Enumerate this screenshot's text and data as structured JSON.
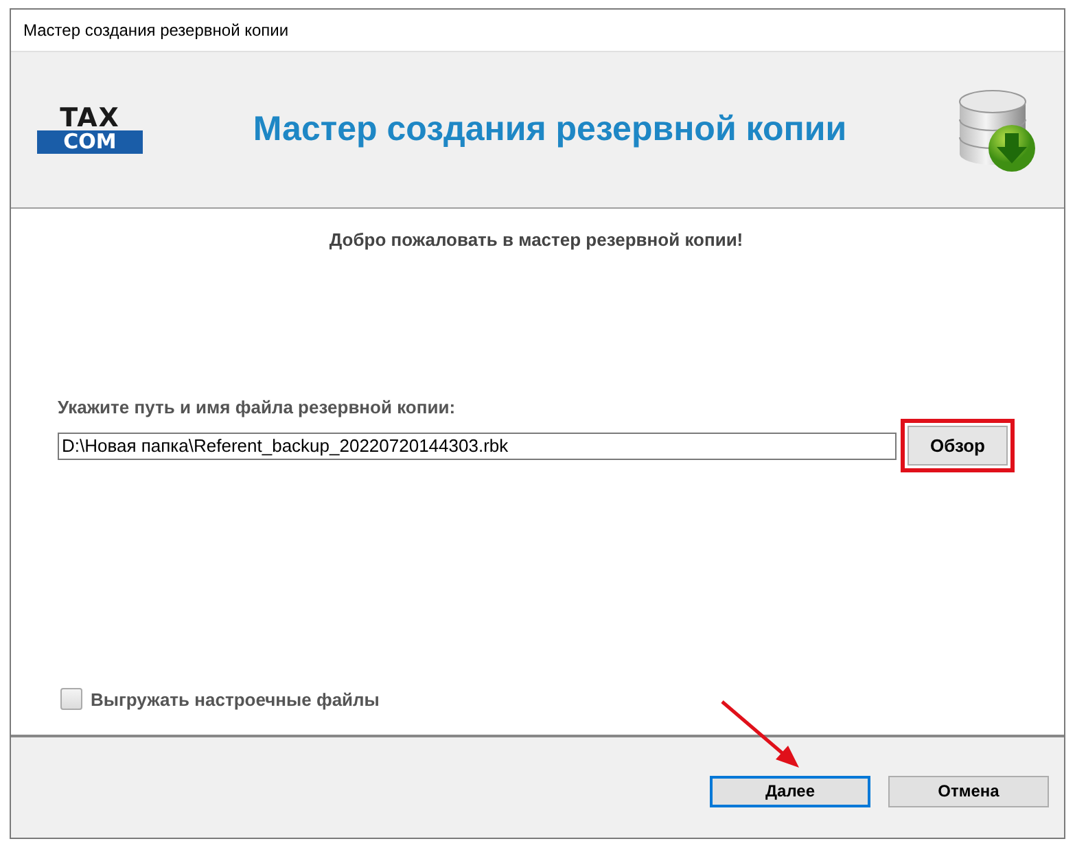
{
  "window": {
    "title": "Мастер создания резервной копии"
  },
  "header": {
    "logo_top": "TAX",
    "logo_bottom": "COM",
    "title": "Мастер создания резервной копии"
  },
  "welcome": "Добро пожаловать в мастер резервной копии!",
  "path": {
    "label": "Укажите путь и имя файла резервной копии:",
    "value": "D:\\Новая папка\\Referent_backup_20220720144303.rbk",
    "browse": "Обзор",
    "highlighted": true
  },
  "export_settings": {
    "label": "Выгружать настроечные файлы",
    "checked": false
  },
  "buttons": [
    {
      "label": "Далее",
      "selected": true
    },
    {
      "label": "Отмена",
      "selected": false
    }
  ],
  "arrow_to_next": true
}
